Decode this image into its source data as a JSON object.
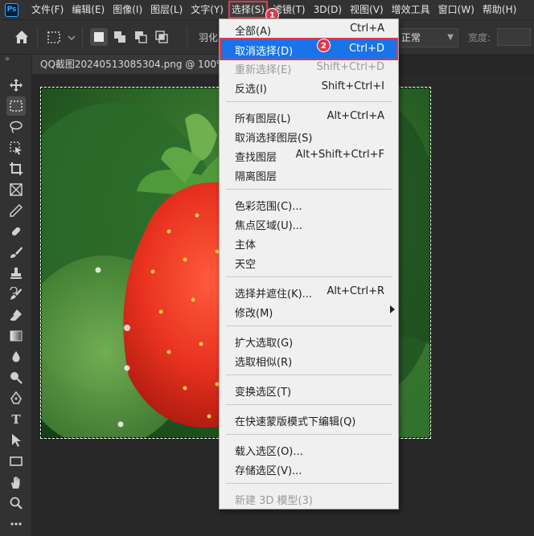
{
  "app": {
    "logo": "Ps"
  },
  "menubar": {
    "items": [
      {
        "label": "文件(F)"
      },
      {
        "label": "编辑(E)"
      },
      {
        "label": "图像(I)"
      },
      {
        "label": "图层(L)"
      },
      {
        "label": "文字(Y)"
      },
      {
        "label": "选择(S)"
      },
      {
        "label": "滤镜(T)"
      },
      {
        "label": "3D(D)"
      },
      {
        "label": "视图(V)"
      },
      {
        "label": "增效工具"
      },
      {
        "label": "窗口(W)"
      },
      {
        "label": "帮助(H)"
      }
    ],
    "active_index": 5
  },
  "options": {
    "feather_label": "羽化:",
    "mode_value": "正常",
    "width_label": "宽度:"
  },
  "document": {
    "tab_title": "QQ截图20240513085304.png @ 100%"
  },
  "badges": {
    "step1": "1",
    "step2": "2"
  },
  "select_menu": {
    "items": [
      {
        "label": "全部(A)",
        "shortcut": "Ctrl+A"
      },
      {
        "label": "取消选择(D)",
        "shortcut": "Ctrl+D",
        "highlighted": true
      },
      {
        "label": "重新选择(E)",
        "shortcut": "Shift+Ctrl+D",
        "disabled": true
      },
      {
        "label": "反选(I)",
        "shortcut": "Shift+Ctrl+I"
      },
      {
        "label": "所有图层(L)",
        "shortcut": "Alt+Ctrl+A"
      },
      {
        "label": "取消选择图层(S)",
        "shortcut": ""
      },
      {
        "label": "查找图层",
        "shortcut": "Alt+Shift+Ctrl+F"
      },
      {
        "label": "隔离图层",
        "shortcut": ""
      },
      {
        "label": "色彩范围(C)...",
        "shortcut": ""
      },
      {
        "label": "焦点区域(U)...",
        "shortcut": ""
      },
      {
        "label": "主体",
        "shortcut": ""
      },
      {
        "label": "天空",
        "shortcut": ""
      },
      {
        "label": "选择并遮住(K)...",
        "shortcut": "Alt+Ctrl+R"
      },
      {
        "label": "修改(M)",
        "shortcut": "",
        "submenu": true
      },
      {
        "label": "扩大选取(G)",
        "shortcut": ""
      },
      {
        "label": "选取相似(R)",
        "shortcut": ""
      },
      {
        "label": "变换选区(T)",
        "shortcut": ""
      },
      {
        "label": "在快速蒙版模式下编辑(Q)",
        "shortcut": ""
      },
      {
        "label": "载入选区(O)...",
        "shortcut": ""
      },
      {
        "label": "存储选区(V)...",
        "shortcut": ""
      },
      {
        "label": "新建 3D 模型(3)",
        "shortcut": "",
        "disabled": true
      }
    ]
  },
  "colors": {
    "menu_highlight": "#1a73e8",
    "annotation_red": "#e0394a",
    "panel_bg": "#323232",
    "canvas_bg": "#282828"
  },
  "tools": [
    "move-icon",
    "marquee-icon",
    "lasso-icon",
    "object-select-icon",
    "crop-icon",
    "frame-icon",
    "eyedropper-icon",
    "healing-icon",
    "brush-icon",
    "stamp-icon",
    "history-brush-icon",
    "eraser-icon",
    "gradient-icon",
    "blur-icon",
    "dodge-icon",
    "pen-icon",
    "type-icon",
    "path-select-icon",
    "rectangle-icon",
    "hand-icon",
    "zoom-icon",
    "more-icon"
  ]
}
